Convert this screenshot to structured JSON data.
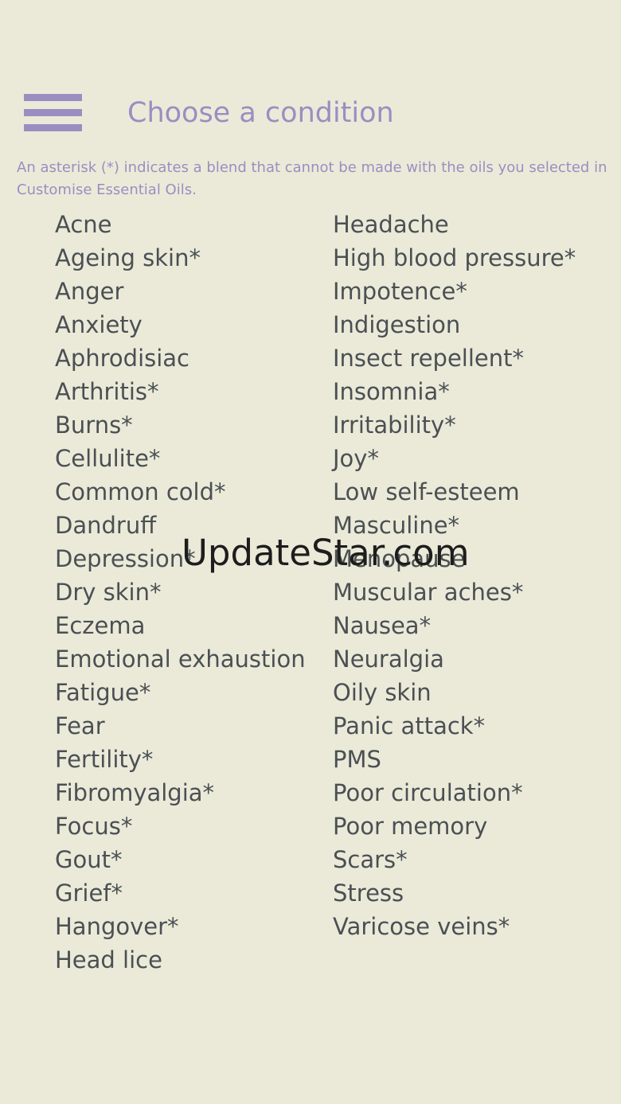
{
  "header": {
    "menu_icon": "hamburger-menu-icon",
    "title": "Choose a condition"
  },
  "note": "An asterisk (*) indicates a blend that cannot be made with the oils you selected in Customise Essential Oils.",
  "conditions": {
    "left": [
      "Acne",
      "Ageing skin*",
      "Anger",
      "Anxiety",
      "Aphrodisiac",
      "Arthritis*",
      "Burns*",
      "Cellulite*",
      "Common cold*",
      "Dandruff",
      "Depression*",
      "Dry skin*",
      "Eczema",
      "Emotional exhaustion",
      "Fatigue*",
      "Fear",
      "Fertility*",
      "Fibromyalgia*",
      "Focus*",
      "Gout*",
      "Grief*",
      "Hangover*",
      "Head lice"
    ],
    "right": [
      "Headache",
      "High blood pressure*",
      "Impotence*",
      "Indigestion",
      "Insect repellent*",
      "Insomnia*",
      "Irritability*",
      "Joy*",
      "Low self-esteem",
      "Masculine*",
      "Menopause",
      "Muscular aches*",
      "Nausea*",
      "Neuralgia",
      "Oily skin",
      "Panic attack*",
      "PMS",
      "Poor circulation*",
      "Poor memory",
      "Scars*",
      "Stress",
      "Varicose veins*"
    ]
  },
  "watermark": "UpdateStar.com",
  "colors": {
    "background": "#ebead9",
    "accent": "#9a8ec1",
    "text": "#4a5053"
  }
}
